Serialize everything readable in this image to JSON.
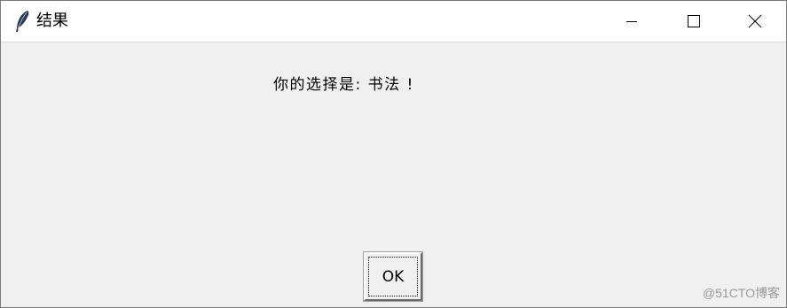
{
  "window": {
    "title": "结果",
    "app_icon": "feather-icon",
    "controls": {
      "minimize": "minimize-icon",
      "maximize": "maximize-icon",
      "close": "close-icon"
    }
  },
  "dialog": {
    "message": "你的选择是: 书法 !",
    "ok_label": "OK"
  },
  "watermark": "@51CTO博客",
  "colors": {
    "titlebar": "#ffffff",
    "client": "#f0f0f0",
    "border": "#7a7a7a"
  }
}
